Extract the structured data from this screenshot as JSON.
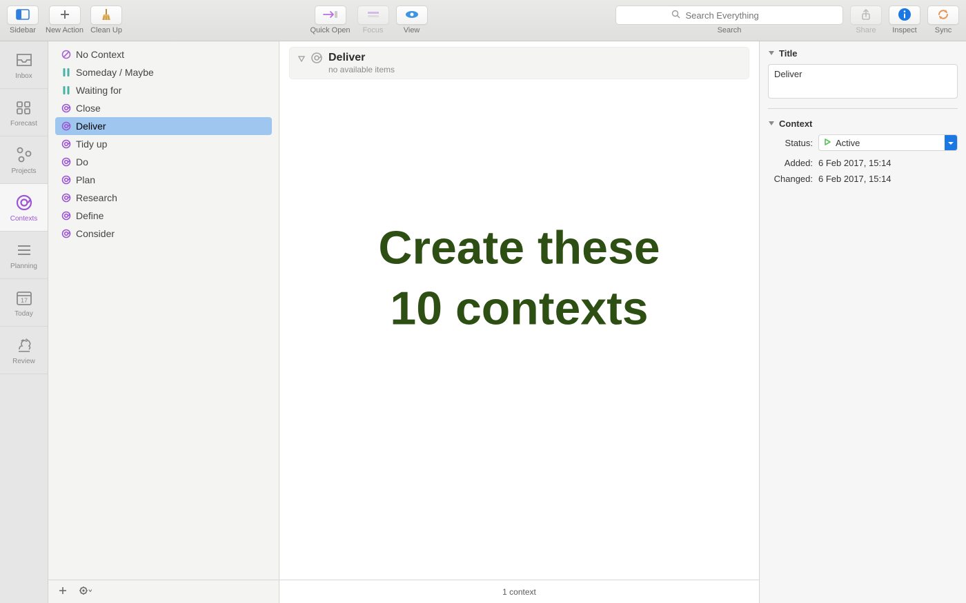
{
  "toolbar": {
    "sidebar": "Sidebar",
    "new_action": "New Action",
    "clean_up": "Clean Up",
    "quick_open": "Quick Open",
    "focus": "Focus",
    "view": "View",
    "share": "Share",
    "inspect": "Inspect",
    "sync": "Sync",
    "search": {
      "label": "Search",
      "placeholder": "Search Everything"
    }
  },
  "perspectives": [
    {
      "id": "inbox",
      "label": "Inbox"
    },
    {
      "id": "forecast",
      "label": "Forecast"
    },
    {
      "id": "projects",
      "label": "Projects"
    },
    {
      "id": "contexts",
      "label": "Contexts"
    },
    {
      "id": "planning",
      "label": "Planning"
    },
    {
      "id": "today",
      "label": "Today",
      "badge": "17"
    },
    {
      "id": "review",
      "label": "Review"
    }
  ],
  "contexts": [
    {
      "name": "No Context",
      "type": "noctx"
    },
    {
      "name": "Someday / Maybe",
      "type": "paused"
    },
    {
      "name": "Waiting for",
      "type": "paused"
    },
    {
      "name": "Close",
      "type": "ctx"
    },
    {
      "name": "Deliver",
      "type": "ctx",
      "selected": true
    },
    {
      "name": "Tidy up",
      "type": "ctx"
    },
    {
      "name": "Do",
      "type": "ctx"
    },
    {
      "name": "Plan",
      "type": "ctx"
    },
    {
      "name": "Research",
      "type": "ctx"
    },
    {
      "name": "Define",
      "type": "ctx"
    },
    {
      "name": "Consider",
      "type": "ctx"
    }
  ],
  "outline": {
    "header_title": "Deliver",
    "header_sub": "no available items",
    "footer": "1 context"
  },
  "overlay": "Create these\n10 contexts",
  "inspector": {
    "title_label": "Title",
    "title_value": "Deliver",
    "context_label": "Context",
    "status_label": "Status:",
    "status_value": "Active",
    "added_label": "Added:",
    "added_value": "6 Feb 2017, 15:14",
    "changed_label": "Changed:",
    "changed_value": "6 Feb 2017, 15:14"
  }
}
